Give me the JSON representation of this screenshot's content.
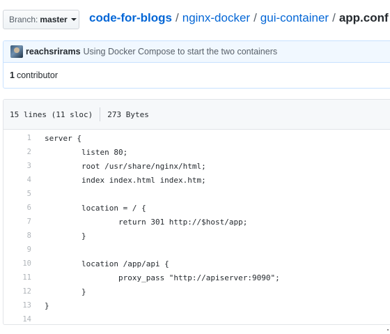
{
  "header": {
    "branch_label": "Branch:",
    "branch_name": "master",
    "breadcrumb": {
      "repo": "code-for-blogs",
      "sep1": "/",
      "dir1": "nginx-docker",
      "sep2": "/",
      "dir2": "gui-container",
      "sep3": "/",
      "file": "app.conf"
    }
  },
  "commit": {
    "author": "reachsrirams",
    "message": "Using Docker Compose to start the two containers",
    "contributors_count": "1",
    "contributors_label": "contributor"
  },
  "file": {
    "lines_info": "15 lines (11 sloc)",
    "size": "273 Bytes",
    "lines": [
      {
        "num": "1",
        "text": "server {"
      },
      {
        "num": "2",
        "text": "        listen 80;"
      },
      {
        "num": "3",
        "text": "        root /usr/share/nginx/html;"
      },
      {
        "num": "4",
        "text": "        index index.html index.htm;"
      },
      {
        "num": "5",
        "text": ""
      },
      {
        "num": "6",
        "text": "        location = / {"
      },
      {
        "num": "7",
        "text": "                return 301 http://$host/app;"
      },
      {
        "num": "8",
        "text": "        }"
      },
      {
        "num": "9",
        "text": ""
      },
      {
        "num": "10",
        "text": "        location /app/api {"
      },
      {
        "num": "11",
        "text": "                proxy_pass \"http://apiserver:9090\";"
      },
      {
        "num": "12",
        "text": "        }"
      },
      {
        "num": "13",
        "text": "}"
      },
      {
        "num": "14",
        "text": ""
      }
    ]
  },
  "colors": {
    "link": "#0366d6",
    "commit_bg": "#f1f8ff",
    "commit_border": "#c8e1ff",
    "file_header_bg": "#f6f8fa",
    "line_number": "#b0b5ba"
  }
}
